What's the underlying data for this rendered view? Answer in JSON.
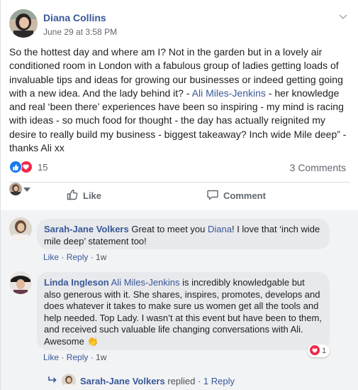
{
  "post": {
    "author": "Diana Collins",
    "timestamp": "June 29 at 3:58 PM",
    "body_part1": "So the hottest day and where am I? Not in the garden but in a lovely air conditioned room in London with a fabulous group of ladies getting loads of invaluable tips and ideas for growing our businesses or indeed getting going with a new idea. And the lady behind it? - ",
    "mention": "Ali Miles-Jenkins",
    "body_part2": " - her knowledge and real ‘been there’ experiences have been so inspiring - my mind is racing with ideas - so much food for thought - the day has actually reignited my desire to really build my business - biggest takeaway? Inch wide Mile deep” - thanks Ali xx",
    "reaction_count": "15",
    "comment_count": "3 Comments"
  },
  "actions": {
    "like_label": "Like",
    "comment_label": "Comment"
  },
  "comments": [
    {
      "author": "Sarah-Jane Volkers",
      "text_part1": " Great to meet you ",
      "mention": "Diana",
      "text_part2": "! I love that ‘inch wide mile deep’ statement too!",
      "like": "Like",
      "reply": "Reply",
      "sep": " · ",
      "time": "1w"
    },
    {
      "author": "Linda Ingleson",
      "mention": "Ali Miles-Jenkins",
      "text": " is incredibly knowledgable but also generous with it. She shares, inspires, promotes, develops and does whatever it takes to make sure us women get all the tools and help needed. Top Lady. I wasn’t at this event but have been to them, and received such valuable life changing conversations with Ali. Awesome 👏",
      "like": "Like",
      "reply": "Reply",
      "sep": " · ",
      "time": "1w",
      "reaction_count": "1"
    }
  ],
  "reply_summary": {
    "who": "Sarah-Jane Volkers",
    "action": " replied",
    "sep": " · ",
    "count": "1 Reply"
  },
  "colors": {
    "link": "#385898",
    "like_blue": "#1877f2",
    "love_red": "#f0284a"
  },
  "icons": {
    "like_action": "thumbs-up-icon",
    "comment_action": "speech-bubble-icon",
    "reply_arrow": "reply-arrow-icon",
    "menu": "chevron-down-icon"
  }
}
